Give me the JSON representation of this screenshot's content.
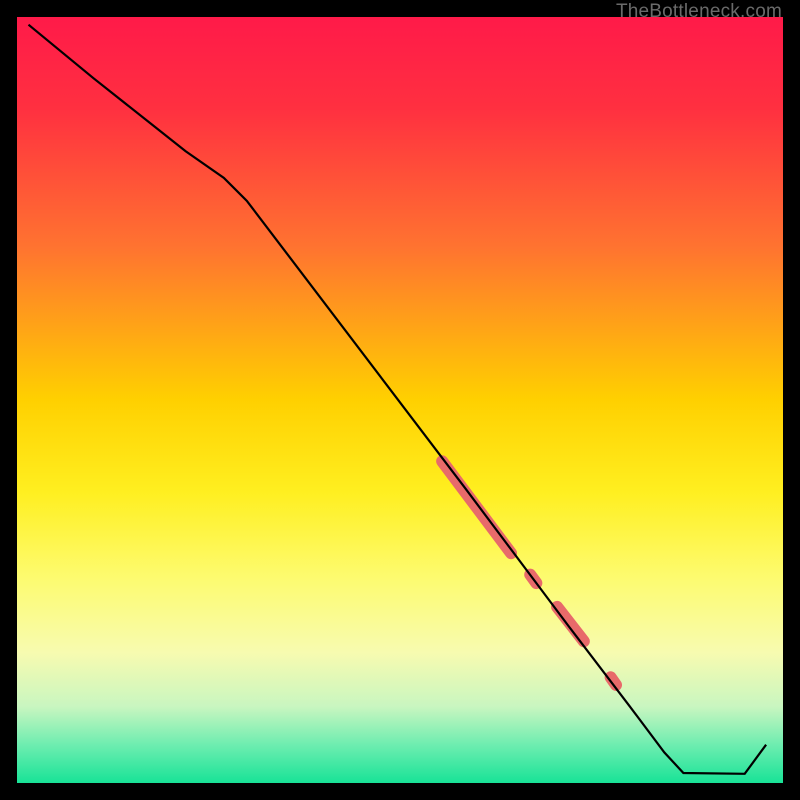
{
  "watermark": "TheBottleneck.com",
  "chart_data": {
    "type": "line",
    "title": "",
    "xlabel": "",
    "ylabel": "",
    "xlim": [
      0,
      100
    ],
    "ylim": [
      0,
      100
    ],
    "gradient_stops": [
      {
        "offset": 0.0,
        "color": "#ff1a49"
      },
      {
        "offset": 0.12,
        "color": "#ff3040"
      },
      {
        "offset": 0.3,
        "color": "#ff7330"
      },
      {
        "offset": 0.5,
        "color": "#ffd000"
      },
      {
        "offset": 0.62,
        "color": "#ffef20"
      },
      {
        "offset": 0.73,
        "color": "#fdfb6e"
      },
      {
        "offset": 0.83,
        "color": "#f7fbb0"
      },
      {
        "offset": 0.9,
        "color": "#c9f6c0"
      },
      {
        "offset": 0.95,
        "color": "#6eedb0"
      },
      {
        "offset": 1.0,
        "color": "#18e397"
      }
    ],
    "series": [
      {
        "name": "bottleneck-curve",
        "color": "#000000",
        "points": [
          {
            "x": 1.5,
            "y": 99.0
          },
          {
            "x": 10.0,
            "y": 92.0
          },
          {
            "x": 22.0,
            "y": 82.5
          },
          {
            "x": 27.0,
            "y": 79.0
          },
          {
            "x": 30.0,
            "y": 76.0
          },
          {
            "x": 58.5,
            "y": 38.5
          },
          {
            "x": 72.0,
            "y": 20.5
          },
          {
            "x": 80.0,
            "y": 10.0
          },
          {
            "x": 84.5,
            "y": 4.0
          },
          {
            "x": 87.0,
            "y": 1.3
          },
          {
            "x": 95.0,
            "y": 1.2
          },
          {
            "x": 97.8,
            "y": 5.0
          }
        ]
      }
    ],
    "highlight_segments": [
      {
        "x1": 55.5,
        "y1": 42.0,
        "x2": 64.5,
        "y2": 30.0
      },
      {
        "x1": 67.0,
        "y1": 27.2,
        "x2": 67.8,
        "y2": 26.1
      },
      {
        "x1": 70.5,
        "y1": 23.0,
        "x2": 74.0,
        "y2": 18.5
      },
      {
        "x1": 77.5,
        "y1": 13.8,
        "x2": 78.2,
        "y2": 12.8
      }
    ],
    "highlight_color": "#e86a6a"
  }
}
